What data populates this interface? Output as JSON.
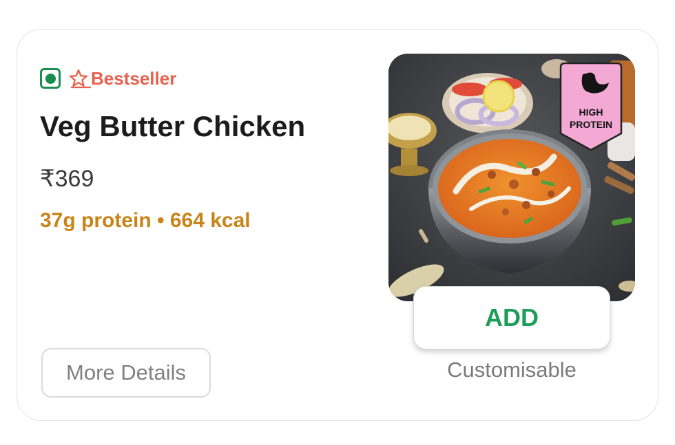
{
  "item": {
    "badge": "Bestseller",
    "title": "Veg Butter Chicken",
    "price": "₹369",
    "nutrition": "37g protein • 664 kcal",
    "image_tag": [
      "HIGH",
      "PROTEIN"
    ]
  },
  "actions": {
    "more_details": "More Details",
    "add": "ADD",
    "customisable": "Customisable"
  },
  "colors": {
    "veg_green": "#1a8e4f",
    "bestseller": "#e8604c",
    "nutrition": "#c88418",
    "add_green": "#1e9c5a",
    "protein_tag_bg": "#f4a9d4"
  },
  "icons": {
    "veg": "veg-indicator-icon",
    "star": "star-outline-icon",
    "muscle": "flexed-arm-icon"
  }
}
